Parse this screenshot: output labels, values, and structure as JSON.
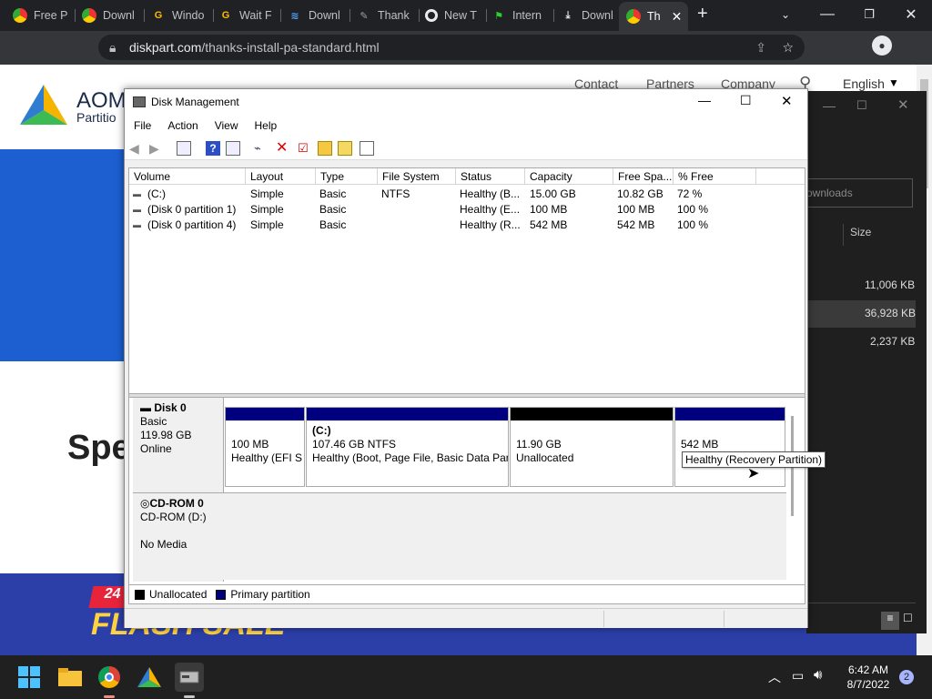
{
  "tabs": [
    {
      "label": "Free P",
      "icon": "chrome-multicolor-icon"
    },
    {
      "label": "Downl",
      "icon": "chrome-multicolor-icon"
    },
    {
      "label": "Windo",
      "icon": "google-g-icon"
    },
    {
      "label": "Wait F",
      "icon": "google-g-icon"
    },
    {
      "label": "Downl",
      "icon": "steam-like-icon"
    },
    {
      "label": "Thank",
      "icon": "tool-icon"
    },
    {
      "label": "New T",
      "icon": "chrome-icon"
    },
    {
      "label": "Intern",
      "icon": "green-flag-icon"
    },
    {
      "label": "Downl",
      "icon": "download-icon"
    },
    {
      "label": "Th",
      "icon": "chrome-multicolor-icon"
    }
  ],
  "address": {
    "url_domain": "diskpart.com",
    "url_path": "/thanks-install-pa-standard.html"
  },
  "page": {
    "logo_text": "AOM",
    "logo_sub": "Partitio",
    "nav": [
      "Contact",
      "Partners",
      "Company"
    ],
    "language": "English",
    "heading": "Spe",
    "flash_badge": "24",
    "flash_text": "FLASH SALE"
  },
  "dark_window": {
    "search": "ownloads",
    "col_size": "Size",
    "sizes": [
      "11,006 KB",
      "36,928 KB",
      "2,237 KB"
    ]
  },
  "dm": {
    "title": "Disk Management",
    "menu": [
      "File",
      "Action",
      "View",
      "Help"
    ],
    "columns": [
      "Volume",
      "Layout",
      "Type",
      "File System",
      "Status",
      "Capacity",
      "Free Spa...",
      "% Free"
    ],
    "rows": [
      [
        "(C:)",
        "Simple",
        "Basic",
        "NTFS",
        "Healthy (B...",
        "15.00 GB",
        "10.82 GB",
        "72 %"
      ],
      [
        "(Disk 0 partition 1)",
        "Simple",
        "Basic",
        "",
        "Healthy (E...",
        "100 MB",
        "100 MB",
        "100 %"
      ],
      [
        "(Disk 0 partition 4)",
        "Simple",
        "Basic",
        "",
        "Healthy (R...",
        "542 MB",
        "542 MB",
        "100 %"
      ]
    ],
    "disk0": {
      "name": "Disk 0",
      "type": "Basic",
      "size": "119.98 GB",
      "state": "Online"
    },
    "partitions": [
      {
        "l1": "",
        "l2": "100 MB",
        "l3": "Healthy (EFI S"
      },
      {
        "l1": "(C:)",
        "l2": "107.46 GB NTFS",
        "l3": "Healthy (Boot, Page File, Basic Data Part"
      },
      {
        "l1": "",
        "l2": "11.90 GB",
        "l3": "Unallocated"
      },
      {
        "l1": "",
        "l2": "542 MB",
        "l3": ""
      }
    ],
    "tooltip": "Healthy (Recovery Partition)",
    "cdrom": {
      "name": "CD-ROM 0",
      "drive": "CD-ROM (D:)",
      "media": "No Media"
    },
    "legend": [
      "Unallocated",
      "Primary partition"
    ],
    "colors": {
      "primary": "#00007f",
      "unallocated": "#000000"
    }
  },
  "taskbar": {
    "time": "6:42 AM",
    "date": "8/7/2022",
    "notif": "2"
  }
}
